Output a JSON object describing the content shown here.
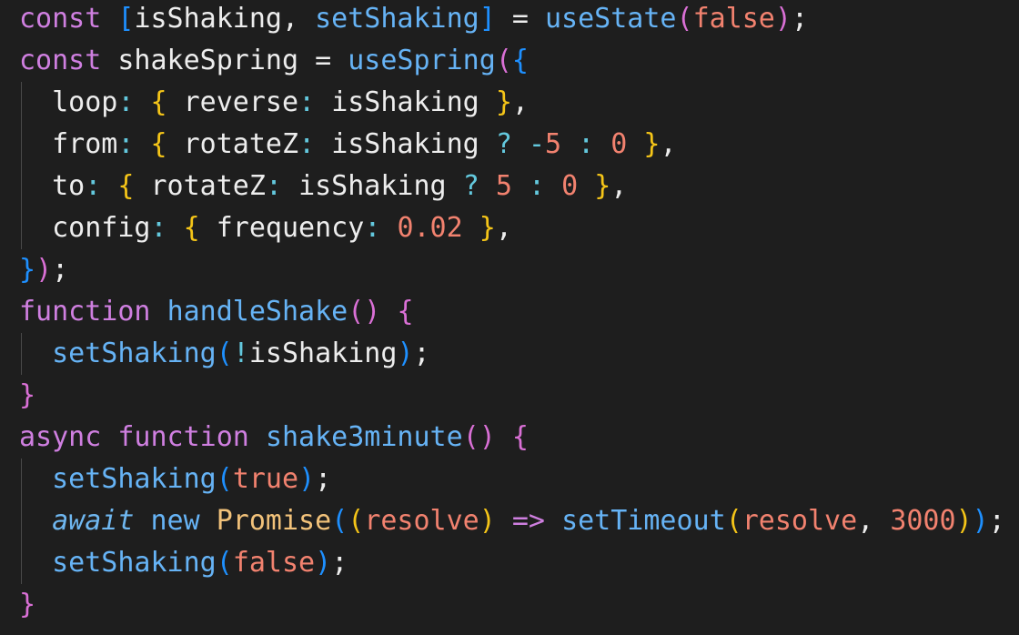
{
  "code": {
    "language": "javascript",
    "lines": [
      "const [isShaking, setShaking] = useState(false);",
      "const shakeSpring = useSpring({",
      "  loop: { reverse: isShaking },",
      "  from: { rotateZ: isShaking ? -5 : 0 },",
      "  to: { rotateZ: isShaking ? 5 : 0 },",
      "  config: { frequency: 0.02 },",
      "});",
      "function handleShake() {",
      "  setShaking(!isShaking);",
      "}",
      "async function shake3minute() {",
      "  setShaking(true);",
      "  await new Promise((resolve) => setTimeout(resolve, 3000));",
      "  setShaking(false);",
      "}"
    ]
  },
  "theme": {
    "background": "#1e1e1e",
    "keyword": "#cf7fe0",
    "function": "#66b3f5",
    "number": "#f2826f",
    "class": "#f2c27a",
    "operator": "#63c8dd",
    "bracket_gold": "#f5c518",
    "bracket_orchid": "#da70d6",
    "bracket_blue": "#1e90ff"
  },
  "tokens": {
    "const": "const",
    "function": "function",
    "async": "async",
    "await": "await",
    "new": "new",
    "true": "true",
    "false": "false",
    "isShaking": "isShaking",
    "setShaking": "setShaking",
    "useState": "useState",
    "shakeSpring": "shakeSpring",
    "useSpring": "useSpring",
    "loop": "loop",
    "reverse": "reverse",
    "from": "from",
    "to": "to",
    "rotateZ": "rotateZ",
    "config": "config",
    "frequency": "frequency",
    "n5": "5",
    "n0": "0",
    "n002": "0.02",
    "n3000": "3000",
    "handleShake": "handleShake",
    "shake3minute": "shake3minute",
    "Promise": "Promise",
    "resolve": "resolve",
    "setTimeout": "setTimeout"
  }
}
